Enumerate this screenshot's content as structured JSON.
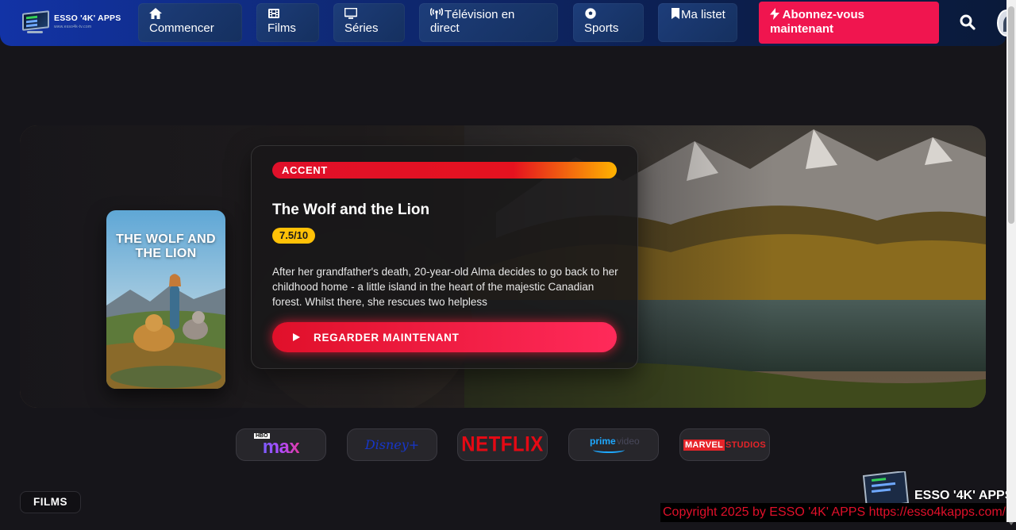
{
  "header": {
    "logo_text": "ESSO '4K' APPS",
    "logo_sub": "www.esso4k-tv.com",
    "nav": [
      {
        "label": "Commencer",
        "icon": "home-icon"
      },
      {
        "label": "Films",
        "icon": "film-icon"
      },
      {
        "label": "Séries",
        "icon": "tv-icon"
      },
      {
        "label": "Télévision en direct",
        "icon": "broadcast-icon"
      },
      {
        "label": "Sports",
        "icon": "soccer-ball-icon"
      },
      {
        "label": "Ma listet",
        "icon": "bookmark-icon"
      }
    ],
    "cta_label": "Abonnez-vous maintenant",
    "cta_icon": "lightning-icon",
    "search_icon": "search-icon",
    "colors": {
      "cta": "#f0154f",
      "nav_bg": "#15305f"
    }
  },
  "hero": {
    "badge": "ACCENT",
    "title": "The Wolf and the Lion",
    "rating": "7.5/10",
    "description": "After her grandfather's death, 20-year-old Alma decides to go back to her childhood home - a little island in the heart of the majestic Canadian forest. Whilst there, she rescues two helpless",
    "watch_label": "REGARDER MAINTENANT",
    "poster_title": "THE WOLF AND THE LION",
    "colors": {
      "accent": "#e0102a",
      "rating": "#ffc107"
    }
  },
  "providers": [
    {
      "name": "max",
      "badge": "HBO"
    },
    {
      "name": "Disney+"
    },
    {
      "name": "NETFLIX"
    },
    {
      "name": "prime",
      "extra": "video"
    },
    {
      "name": "MARVEL",
      "extra": "STUDIOS"
    }
  ],
  "section_label": "FILMS",
  "watermark": {
    "text": "ESSO '4K' APPS",
    "copyright": "Copyright 2025  by ESSO '4K' APPS https://esso4kapps.com/"
  }
}
